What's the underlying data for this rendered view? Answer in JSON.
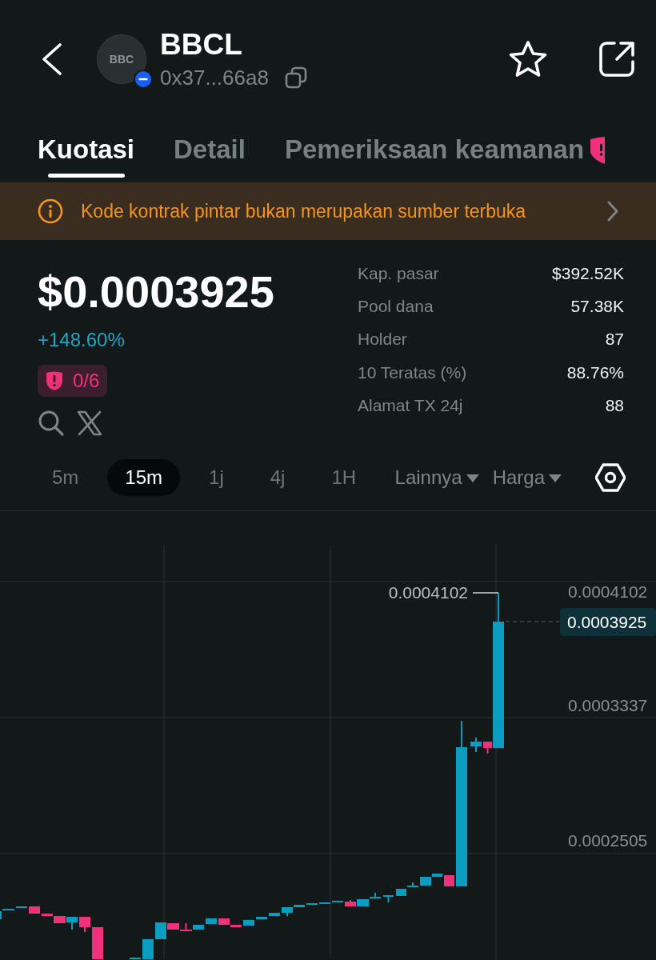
{
  "header": {
    "avatar_text": "BBC",
    "title": "BBCL",
    "address": "0x37...66a8"
  },
  "tabs": [
    {
      "label": "Kuotasi",
      "selected": true,
      "alert": false
    },
    {
      "label": "Detail",
      "selected": false,
      "alert": false
    },
    {
      "label": "Pemeriksaan keamanan",
      "selected": false,
      "alert": true
    }
  ],
  "notice": {
    "text": "Kode kontrak pintar bukan merupakan sumber terbuka"
  },
  "price": {
    "value": "$0.0003925",
    "change": "+148.60%",
    "security_score": "0/6"
  },
  "stats": [
    {
      "label": "Kap. pasar",
      "value": "$392.52K"
    },
    {
      "label": "Pool dana",
      "value": "57.38K"
    },
    {
      "label": "Holder",
      "value": "87"
    },
    {
      "label": "10 Teratas (%)",
      "value": "88.76%"
    },
    {
      "label": "Alamat TX 24j",
      "value": "88"
    }
  ],
  "intervals": [
    {
      "label": "5m",
      "selected": false
    },
    {
      "label": "15m",
      "selected": true
    },
    {
      "label": "1j",
      "selected": false
    },
    {
      "label": "4j",
      "selected": false
    },
    {
      "label": "1H",
      "selected": false
    }
  ],
  "dropdowns": [
    {
      "label": "Lainnya"
    },
    {
      "label": "Harga"
    }
  ],
  "chart": {
    "price_scale": [
      "0.0004102",
      "0.0003337",
      "0.0002505"
    ],
    "high_label": "0.0004102",
    "last_price": "0.0003925"
  }
}
